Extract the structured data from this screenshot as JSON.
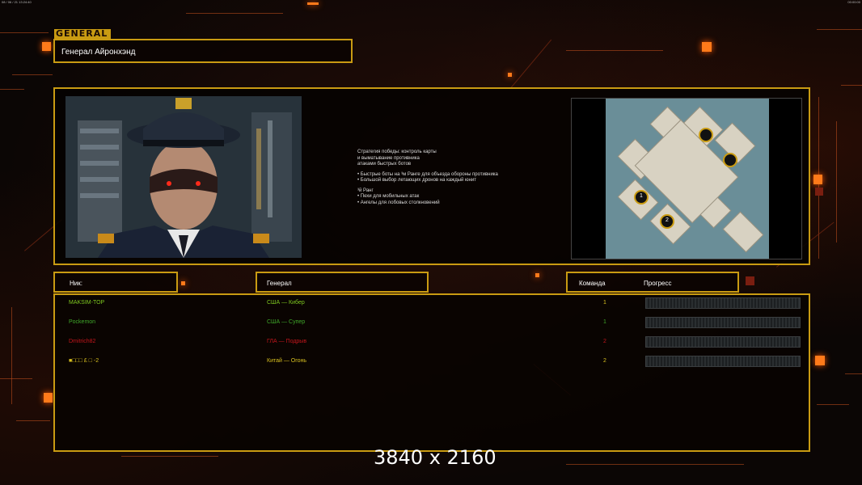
{
  "system_bar": {
    "left_text": "08 / 06 / 21 13:24:40",
    "right_text": "00:00:00"
  },
  "header": {
    "logo_text": "GENERAL",
    "general_name": "Генерал Айронхэнд"
  },
  "strategy": {
    "line1": "Стратегия победы: контроль карты",
    "line2": "и выматывание противника",
    "line3": "атаками быстрых ботов",
    "bullet1": "• Быстрые боты на ³м Ранге для объезда обороны противника",
    "bullet2": "• Большой выбор летающих дронов на каждый юнит",
    "rank_label": "³й Ранг",
    "bullet3": "• Пехи для мобильных атак",
    "bullet4": "• Ангелы для лобовых столкновений"
  },
  "map": {
    "markers": [
      "1",
      "2"
    ]
  },
  "columns": {
    "nick": "Ник:",
    "general": "Генерал",
    "team": "Команда",
    "progress": "Прогресс"
  },
  "players": [
    {
      "nick": "MAKSIM-TOP",
      "general": "США — Кибер",
      "team": "1",
      "color": "#7ec820"
    },
    {
      "nick": "Pockemon",
      "general": "США — Супер",
      "team": "1",
      "color": "#3fa82a"
    },
    {
      "nick": "Dmitrich82",
      "general": "ГЛА — Подрыв",
      "team": "2",
      "color": "#c4161c"
    },
    {
      "nick": "■□□□ £ □ -2",
      "general": "Китай — Огонь",
      "team": "2",
      "color": "#d8c020"
    }
  ],
  "watermark": "3840 x 2160",
  "colors": {
    "accent_gold": "#c99b12",
    "accent_orange": "#ff7a1a",
    "background": "#0b0605"
  }
}
